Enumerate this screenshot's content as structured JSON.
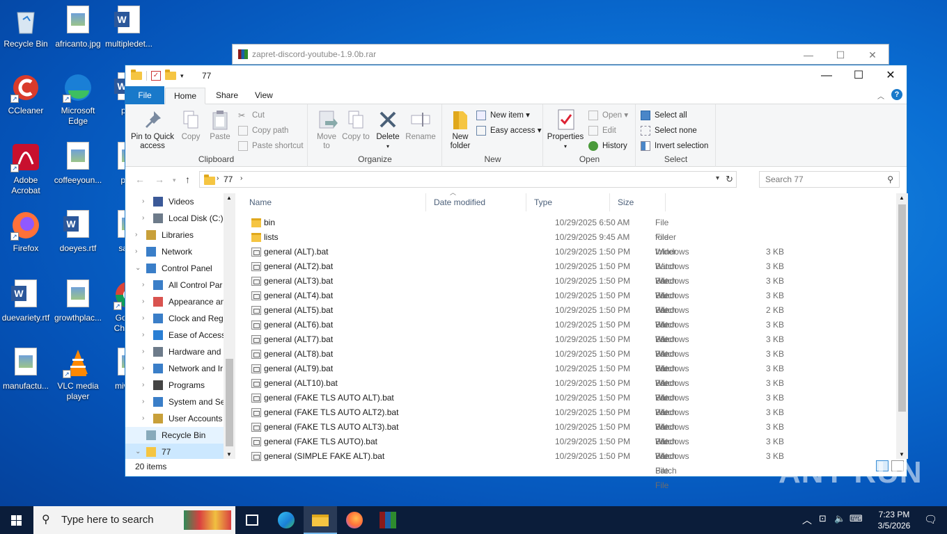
{
  "desktop": {
    "icons": [
      {
        "label": "Recycle Bin",
        "icon": "recycle-bin-icon"
      },
      {
        "label": "africanto.jpg",
        "icon": "image-file-icon"
      },
      {
        "label": "multipledet...",
        "icon": "word-doc-icon"
      },
      {
        "label": "CCleaner",
        "icon": "ccleaner-icon"
      },
      {
        "label": "Microsoft Edge",
        "icon": "edge-icon"
      },
      {
        "label": "pink",
        "icon": "word-doc-icon"
      },
      {
        "label": "Adobe Acrobat",
        "icon": "acrobat-icon"
      },
      {
        "label": "coffeeyoun...",
        "icon": "image-file-icon"
      },
      {
        "label": "profi",
        "icon": "image-file-icon"
      },
      {
        "label": "Firefox",
        "icon": "firefox-icon"
      },
      {
        "label": "doeyes.rtf",
        "icon": "word-doc-icon"
      },
      {
        "label": "same",
        "icon": "image-file-icon"
      },
      {
        "label": "duevariety.rtf",
        "icon": "word-doc-icon"
      },
      {
        "label": "growthplac...",
        "icon": "image-file-icon"
      },
      {
        "label": "Google Chrome",
        "icon": "chrome-icon"
      },
      {
        "label": "manufactu...",
        "icon": "image-file-icon"
      },
      {
        "label": "VLC media player",
        "icon": "vlc-icon"
      },
      {
        "label": "miw.jpg",
        "icon": "image-file-icon"
      }
    ]
  },
  "back_window": {
    "title": "zapret-discord-youtube-1.9.0b.rar"
  },
  "explorer": {
    "title": "77",
    "tabs": {
      "file": "File",
      "home": "Home",
      "share": "Share",
      "view": "View"
    },
    "ribbon": {
      "clipboard": {
        "label": "Clipboard",
        "pin": "Pin to Quick access",
        "copy": "Copy",
        "paste": "Paste",
        "cut": "Cut",
        "copy_path": "Copy path",
        "paste_shortcut": "Paste shortcut"
      },
      "organize": {
        "label": "Organize",
        "move_to": "Move to",
        "copy_to": "Copy to",
        "delete": "Delete",
        "rename": "Rename"
      },
      "new": {
        "label": "New",
        "new_folder": "New folder",
        "new_item": "New item",
        "easy_access": "Easy access"
      },
      "open": {
        "label": "Open",
        "properties": "Properties",
        "open": "Open",
        "edit": "Edit",
        "history": "History"
      },
      "select": {
        "label": "Select",
        "select_all": "Select all",
        "select_none": "Select none",
        "invert": "Invert selection"
      }
    },
    "address": {
      "crumb": "77",
      "search_placeholder": "Search 77"
    },
    "nav": [
      {
        "label": "Videos",
        "indent": 2
      },
      {
        "label": "Local Disk (C:)",
        "indent": 2
      },
      {
        "label": "Libraries",
        "indent": 1
      },
      {
        "label": "Network",
        "indent": 1
      },
      {
        "label": "Control Panel",
        "indent": 1,
        "expanded": true
      },
      {
        "label": "All Control Par",
        "indent": 2
      },
      {
        "label": "Appearance an",
        "indent": 2
      },
      {
        "label": "Clock and Regi",
        "indent": 2
      },
      {
        "label": "Ease of Access",
        "indent": 2
      },
      {
        "label": "Hardware and",
        "indent": 2
      },
      {
        "label": "Network and Ir",
        "indent": 2
      },
      {
        "label": "Programs",
        "indent": 2
      },
      {
        "label": "System and Se",
        "indent": 2
      },
      {
        "label": "User Accounts",
        "indent": 2
      },
      {
        "label": "Recycle Bin",
        "indent": 1,
        "state": "hover"
      },
      {
        "label": "77",
        "indent": 1,
        "expanded": true,
        "state": "selected"
      }
    ],
    "columns": {
      "name": "Name",
      "date": "Date modified",
      "type": "Type",
      "size": "Size"
    },
    "files": [
      {
        "name": "bin",
        "date": "10/29/2025 6:50 AM",
        "type": "File folder",
        "size": "",
        "kind": "folder"
      },
      {
        "name": "lists",
        "date": "10/29/2025 9:45 AM",
        "type": "File folder",
        "size": "",
        "kind": "folder"
      },
      {
        "name": "general (ALT).bat",
        "date": "10/29/2025 1:50 PM",
        "type": "Windows Batch File",
        "size": "3 KB",
        "kind": "bat"
      },
      {
        "name": "general (ALT2).bat",
        "date": "10/29/2025 1:50 PM",
        "type": "Windows Batch File",
        "size": "3 KB",
        "kind": "bat"
      },
      {
        "name": "general (ALT3).bat",
        "date": "10/29/2025 1:50 PM",
        "type": "Windows Batch File",
        "size": "3 KB",
        "kind": "bat"
      },
      {
        "name": "general (ALT4).bat",
        "date": "10/29/2025 1:50 PM",
        "type": "Windows Batch File",
        "size": "3 KB",
        "kind": "bat"
      },
      {
        "name": "general (ALT5).bat",
        "date": "10/29/2025 1:50 PM",
        "type": "Windows Batch File",
        "size": "2 KB",
        "kind": "bat"
      },
      {
        "name": "general (ALT6).bat",
        "date": "10/29/2025 1:50 PM",
        "type": "Windows Batch File",
        "size": "3 KB",
        "kind": "bat"
      },
      {
        "name": "general (ALT7).bat",
        "date": "10/29/2025 1:50 PM",
        "type": "Windows Batch File",
        "size": "3 KB",
        "kind": "bat"
      },
      {
        "name": "general (ALT8).bat",
        "date": "10/29/2025 1:50 PM",
        "type": "Windows Batch File",
        "size": "3 KB",
        "kind": "bat"
      },
      {
        "name": "general (ALT9).bat",
        "date": "10/29/2025 1:50 PM",
        "type": "Windows Batch File",
        "size": "3 KB",
        "kind": "bat"
      },
      {
        "name": "general (ALT10).bat",
        "date": "10/29/2025 1:50 PM",
        "type": "Windows Batch File",
        "size": "3 KB",
        "kind": "bat"
      },
      {
        "name": "general (FAKE TLS AUTO ALT).bat",
        "date": "10/29/2025 1:50 PM",
        "type": "Windows Batch File",
        "size": "3 KB",
        "kind": "bat"
      },
      {
        "name": "general (FAKE TLS AUTO ALT2).bat",
        "date": "10/29/2025 1:50 PM",
        "type": "Windows Batch File",
        "size": "3 KB",
        "kind": "bat"
      },
      {
        "name": "general (FAKE TLS AUTO ALT3).bat",
        "date": "10/29/2025 1:50 PM",
        "type": "Windows Batch File",
        "size": "3 KB",
        "kind": "bat"
      },
      {
        "name": "general (FAKE TLS AUTO).bat",
        "date": "10/29/2025 1:50 PM",
        "type": "Windows Batch File",
        "size": "3 KB",
        "kind": "bat"
      },
      {
        "name": "general (SIMPLE FAKE ALT).bat",
        "date": "10/29/2025 1:50 PM",
        "type": "Windows Batch File",
        "size": "3 KB",
        "kind": "bat"
      }
    ],
    "status": "20 items"
  },
  "watermark": "ANY RUN",
  "taskbar": {
    "search_placeholder": "Type here to search",
    "apps": [
      "task-view-icon",
      "edge-icon",
      "file-explorer-icon",
      "firefox-icon",
      "winrar-icon"
    ],
    "time": "7:23 PM",
    "date": "3/5/2026"
  },
  "colors": {
    "accent": "#1979ca",
    "selected": "#cce8ff",
    "taskbar": "#0b1d3a"
  }
}
